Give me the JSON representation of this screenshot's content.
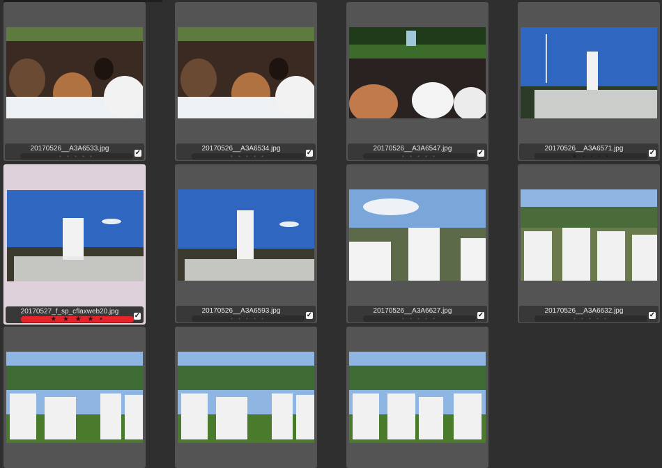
{
  "photos": [
    {
      "file": "20170526__A3A6533.jpg",
      "rating": "• • • • •",
      "checked": "✓"
    },
    {
      "file": "20170526__A3A6534.jpg",
      "rating": "• • • • •",
      "checked": "✓"
    },
    {
      "file": "20170526__A3A6547.jpg",
      "rating": "• • • • •",
      "checked": "✓"
    },
    {
      "file": "20170526__A3A6571.jpg",
      "rating": "★ • • • •",
      "checked": "✓"
    },
    {
      "file": "20170527_f_sp_cflaxweb20.jpg",
      "rating": "★ ★ ★ ★ •",
      "checked": "✓"
    },
    {
      "file": "20170526__A3A6593.jpg",
      "rating": "• • • • •",
      "checked": "✓"
    },
    {
      "file": "20170526__A3A6627.jpg",
      "rating": "• • • • •",
      "checked": "✓"
    },
    {
      "file": "20170526__A3A6632.jpg",
      "rating": "• • • • •",
      "checked": "✓"
    },
    {
      "file": "",
      "rating": "",
      "checked": ""
    },
    {
      "file": "",
      "rating": "",
      "checked": ""
    },
    {
      "file": "",
      "rating": "",
      "checked": ""
    }
  ],
  "colors": {
    "background": "#2f2f2f",
    "cell": "#545454",
    "selected_cell": "#dfd1db",
    "red_label": "#e3242b"
  },
  "icons": {
    "checkbox": "checkbox-checked-icon",
    "star": "star-icon"
  }
}
